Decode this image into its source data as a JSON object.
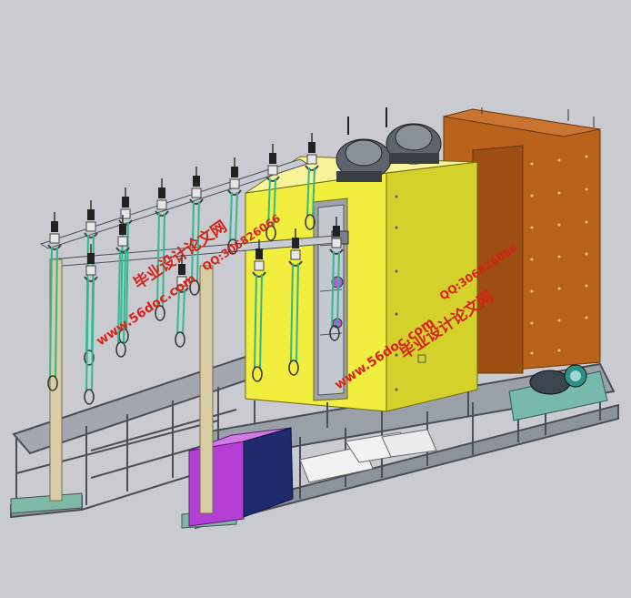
{
  "colors": {
    "background": "#c9cbd0",
    "frame": "#7a8088",
    "frame_dark": "#4a4f57",
    "yellow_cabinet": "#f1ee3e",
    "orange_cabinet": "#b8621b",
    "purple_tank": "#b43fd6",
    "navy_tank": "#1f2a6e",
    "green_cable": "#2eb890",
    "watermark": "#d6231a"
  },
  "watermarks": {
    "left_title": "毕业设计论文网",
    "left_qq": "QQ:306826066",
    "left_url": "www.56doc.com",
    "right_title": "毕业设计论文网",
    "right_qq": "QQ:306826066",
    "right_url": "www.56doc.com"
  },
  "icons": {
    "blower": "blower-motor-icon",
    "pump": "pump-motor-icon",
    "gripper": "gripper-hook-icon"
  }
}
